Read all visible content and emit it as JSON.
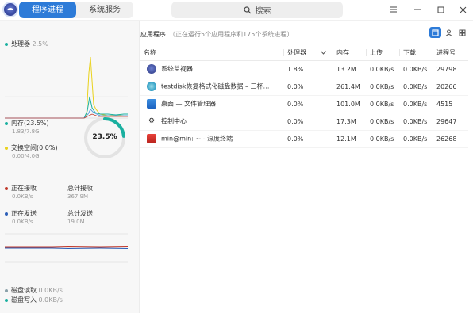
{
  "tabs": [
    {
      "label": "程序进程",
      "active": true
    },
    {
      "label": "系统服务",
      "active": false
    }
  ],
  "search": {
    "label": "搜索"
  },
  "window_buttons": [
    "menu-icon",
    "minimize-icon",
    "maximize-icon",
    "close-icon"
  ],
  "left": {
    "cpu": {
      "label": "处理器",
      "value": "2.5%"
    },
    "memory": {
      "label": "内存(23.5%)",
      "detail": "1.83/7.8G",
      "color": "#1ab0a0"
    },
    "swap": {
      "label": "交换空间(0.0%)",
      "detail": "0.00/4.0G",
      "color": "#e9d21c"
    },
    "gauge": {
      "text": "23.5%",
      "fraction": 0.235
    },
    "net": {
      "recv_label": "正在接收",
      "recv_value": "0.0KB/s",
      "total_recv_label": "总计接收",
      "total_recv_value": "367.9M",
      "send_label": "正在发送",
      "send_value": "0.0KB/s",
      "total_send_label": "总计发送",
      "total_send_value": "19.0M",
      "recv_color": "#c0392b",
      "send_color": "#2d5fb8"
    },
    "disk": {
      "read_label": "磁盘读取",
      "read_value": "0.0KB/s",
      "write_label": "磁盘写入",
      "write_value": "0.0KB/s"
    }
  },
  "right": {
    "title": "应用程序",
    "subtitle": "（正在运行5个应用程序和175个系统进程）",
    "view_buttons": [
      "app-view-icon",
      "user-view-icon",
      "all-view-icon"
    ],
    "columns": [
      "名称",
      "处理器",
      "内存",
      "上传",
      "下载",
      "进程号"
    ],
    "rows": [
      {
        "name": "系统监视器",
        "icon": "system-monitor-icon",
        "cpu": "1.8%",
        "mem": "13.2M",
        "up": "0.0KB/s",
        "down": "0.0KB/s",
        "pid": "29798"
      },
      {
        "name": "testdisk恢复格式化磁盘数据 – 三杯…",
        "icon": "browser-icon",
        "cpu": "0.0%",
        "mem": "261.4M",
        "up": "0.0KB/s",
        "down": "0.0KB/s",
        "pid": "20266"
      },
      {
        "name": "桌面 — 文件管理器",
        "icon": "file-manager-icon",
        "cpu": "0.0%",
        "mem": "101.0M",
        "up": "0.0KB/s",
        "down": "0.0KB/s",
        "pid": "4515"
      },
      {
        "name": "控制中心",
        "icon": "control-center-icon",
        "cpu": "0.0%",
        "mem": "17.3M",
        "up": "0.0KB/s",
        "down": "0.0KB/s",
        "pid": "29647"
      },
      {
        "name": "min@min: ~ - 深度终端",
        "icon": "terminal-icon",
        "cpu": "0.0%",
        "mem": "12.1M",
        "up": "0.0KB/s",
        "down": "0.0KB/s",
        "pid": "26268"
      }
    ]
  }
}
